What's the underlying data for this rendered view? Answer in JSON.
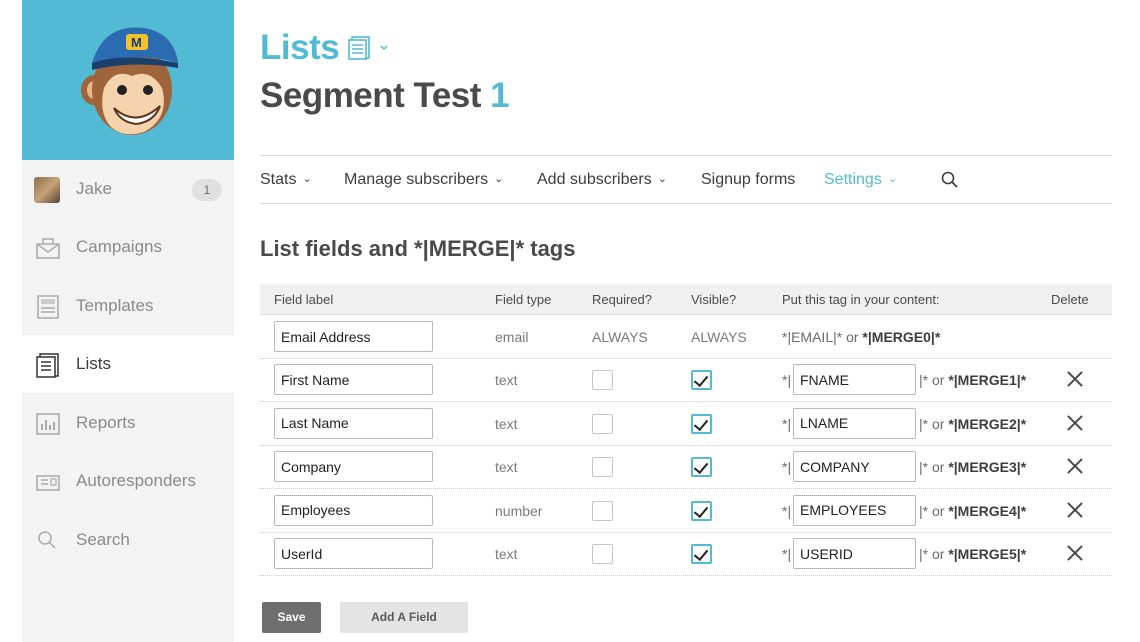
{
  "sidebar": {
    "user": {
      "name": "Jake",
      "badge": "1"
    },
    "items": [
      {
        "label": "Campaigns",
        "icon": "campaigns-icon"
      },
      {
        "label": "Templates",
        "icon": "templates-icon"
      },
      {
        "label": "Lists",
        "icon": "lists-icon",
        "active": true
      },
      {
        "label": "Reports",
        "icon": "reports-icon"
      },
      {
        "label": "Autoresponders",
        "icon": "autoresponders-icon"
      },
      {
        "label": "Search",
        "icon": "search-icon"
      }
    ]
  },
  "header": {
    "breadcrumb": "Lists",
    "title": "Segment Test",
    "count": "1"
  },
  "tabs": [
    {
      "label": "Stats",
      "chevron": true
    },
    {
      "label": "Manage subscribers",
      "chevron": true
    },
    {
      "label": "Add subscribers",
      "chevron": true
    },
    {
      "label": "Signup forms",
      "chevron": false
    },
    {
      "label": "Settings",
      "chevron": true,
      "active": true
    }
  ],
  "section_title": "List fields and *|MERGE|* tags",
  "table": {
    "headers": {
      "field_label": "Field label",
      "field_type": "Field type",
      "required": "Required?",
      "visible": "Visible?",
      "tag": "Put this tag in your content:",
      "delete": "Delete"
    },
    "email_row": {
      "label": "Email Address",
      "type": "email",
      "required": "ALWAYS",
      "visible": "ALWAYS",
      "tag_prefix": "*|EMAIL|* or ",
      "tag_merge": "*|MERGE0|*"
    },
    "rows": [
      {
        "label": "First Name",
        "type": "text",
        "required": false,
        "visible": true,
        "tag": "FNAME",
        "merge": "*|MERGE1|*"
      },
      {
        "label": "Last Name",
        "type": "text",
        "required": false,
        "visible": true,
        "tag": "LNAME",
        "merge": "*|MERGE2|*"
      },
      {
        "label": "Company",
        "type": "text",
        "required": false,
        "visible": true,
        "tag": "COMPANY",
        "merge": "*|MERGE3|*"
      },
      {
        "label": "Employees",
        "type": "number",
        "required": false,
        "visible": true,
        "tag": "EMPLOYEES",
        "merge": "*|MERGE4|*"
      },
      {
        "label": "UserId",
        "type": "text",
        "required": false,
        "visible": true,
        "tag": "USERID",
        "merge": "*|MERGE5|*"
      }
    ],
    "tag_open": "*|",
    "tag_close": "|* or "
  },
  "buttons": {
    "save": "Save",
    "add_field": "Add A Field"
  },
  "colors": {
    "accent": "#52bad5",
    "sidebar_bg": "#f3f3f3"
  }
}
